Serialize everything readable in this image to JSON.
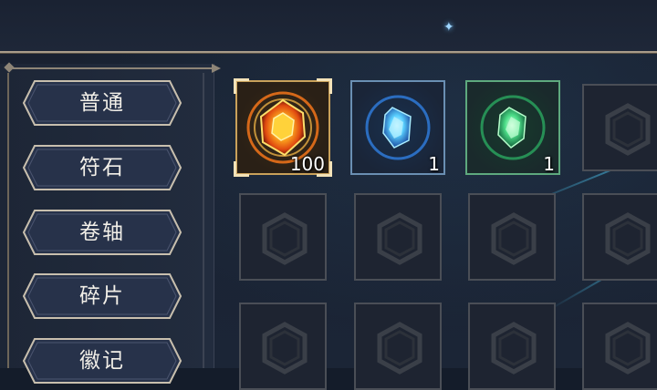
{
  "tabs": [
    {
      "label": "普通",
      "selected": true
    },
    {
      "label": "符石",
      "selected": false
    },
    {
      "label": "卷轴",
      "selected": false
    },
    {
      "label": "碎片",
      "selected": false
    },
    {
      "label": "徽记",
      "selected": false
    }
  ],
  "items": [
    {
      "icon": "orange-rune-gem-icon",
      "quantity": "100",
      "rarity_color": "#c9a15a",
      "selected": true
    },
    {
      "icon": "blue-rune-gem-icon",
      "quantity": "1",
      "rarity_color": "#6a8fb3",
      "selected": false
    },
    {
      "icon": "green-rune-gem-icon",
      "quantity": "1",
      "rarity_color": "#5ea97e",
      "selected": false
    }
  ],
  "empty_slot_icon": "empty-slot-emblem-icon"
}
